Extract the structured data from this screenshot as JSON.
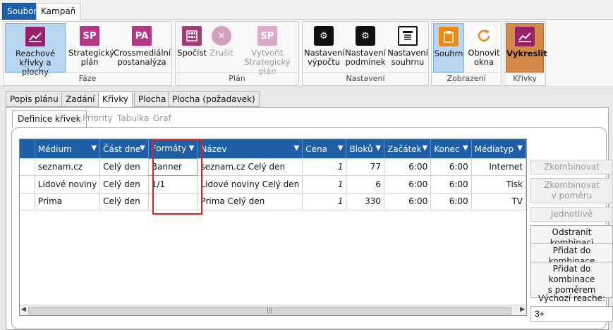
{
  "menu": {
    "file": "Soubor",
    "campaign": "Kampaň"
  },
  "ribbon": {
    "groups": {
      "faze": "Fáze",
      "plan": "Plán",
      "nastaveni": "Nastavení",
      "zobrazeni": "Zobrazení",
      "krivky": "Křivky"
    },
    "buttons": {
      "reach": "Reachové\nkřivky a plochy",
      "strategic": "Strategický\nplán",
      "cross": "Crossmediální\npostanalýza",
      "spocist": "Spočíst",
      "zrusit": "Zrušit",
      "vytvorit": "Vytvořit\nStrategický plán",
      "nast_vypoctu": "Nastavení\nvýpočtu",
      "nast_podminek": "Nastavení\npodmínek",
      "nast_souhrnu": "Nastavení\nsouhrnu",
      "souhrn": "Souhrn",
      "obnovit": "Obnovit\nokna",
      "vykreslit": "Vykreslit"
    },
    "icons": {
      "sp": "SP",
      "pa": "PA"
    }
  },
  "tabs": [
    "Popis plánu",
    "Zadání",
    "Křivky",
    "Plocha",
    "Plocha (požadavek)"
  ],
  "subtabs": [
    "Definice křivek",
    "Priority",
    "Tabulka",
    "Graf"
  ],
  "grid": {
    "columns": [
      "Médium",
      "Část dne",
      "Formáty",
      "Název",
      "Cena",
      "Bloků",
      "Začátek",
      "Konec",
      "Médiatyp"
    ],
    "rows": [
      [
        "seznam.cz",
        "Celý den",
        "Banner",
        "seznam.cz Celý den",
        "1",
        "77",
        "6:00",
        "6:00",
        "Internet"
      ],
      [
        "Lidové noviny",
        "Celý den",
        "1/1",
        "Lidové noviny Celý den",
        "1",
        "6",
        "6:00",
        "6:00",
        "Tisk"
      ],
      [
        "Prima",
        "Celý den",
        "",
        "Prima Celý den",
        "1",
        "330",
        "6:00",
        "6:00",
        "TV"
      ]
    ]
  },
  "side": {
    "zkombinovat": "Zkombinovat",
    "zkombinovat_pomer": "Zkombinovat\nv poměru",
    "jednotlive": "Jednotlivě",
    "odstranit": "Odstranit kombinaci",
    "pridat": "Přidat do kombinace",
    "pridat_pomer": "Přidat do kombinace\ns poměrem",
    "reach_label": "Výchozí reache:",
    "reach_value": "3+"
  }
}
